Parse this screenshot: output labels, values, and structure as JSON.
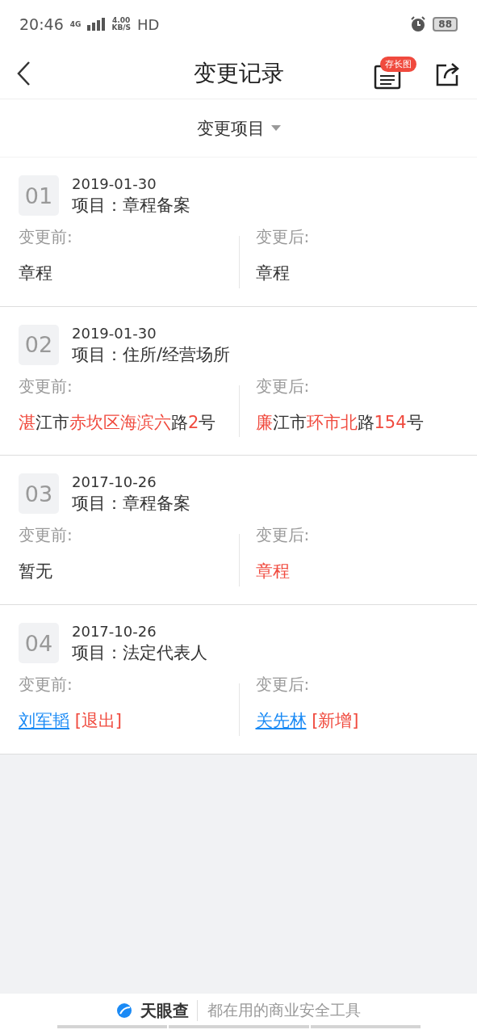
{
  "status_bar": {
    "time": "20:46",
    "network": "4G",
    "speed_value": "4.00",
    "speed_unit": "KB/S",
    "hd": "HD",
    "battery": "88"
  },
  "header": {
    "title": "变更记录",
    "badge": "存长图"
  },
  "filter": {
    "label": "变更项目"
  },
  "records": [
    {
      "index": "01",
      "date": "2019-01-30",
      "item": "项目：章程备案",
      "before_label": "变更前:",
      "after_label": "变更后:",
      "before": [
        {
          "text": "章程",
          "kind": "plain"
        }
      ],
      "after": [
        {
          "text": "章程",
          "kind": "plain"
        }
      ]
    },
    {
      "index": "02",
      "date": "2019-01-30",
      "item": "项目：住所/经营场所",
      "before_label": "变更前:",
      "after_label": "变更后:",
      "before": [
        {
          "text": "湛",
          "kind": "highlight"
        },
        {
          "text": "江市",
          "kind": "plain"
        },
        {
          "text": "赤坎区海滨六",
          "kind": "highlight"
        },
        {
          "text": "路",
          "kind": "plain"
        },
        {
          "text": "2",
          "kind": "highlight"
        },
        {
          "text": "号",
          "kind": "plain"
        }
      ],
      "after": [
        {
          "text": "廉",
          "kind": "highlight"
        },
        {
          "text": "江市",
          "kind": "plain"
        },
        {
          "text": "环市北",
          "kind": "highlight"
        },
        {
          "text": "路",
          "kind": "plain"
        },
        {
          "text": "154",
          "kind": "highlight"
        },
        {
          "text": "号",
          "kind": "plain"
        }
      ]
    },
    {
      "index": "03",
      "date": "2017-10-26",
      "item": "项目：章程备案",
      "before_label": "变更前:",
      "after_label": "变更后:",
      "before": [
        {
          "text": "暂无",
          "kind": "plain"
        }
      ],
      "after": [
        {
          "text": "章程",
          "kind": "highlight"
        }
      ]
    },
    {
      "index": "04",
      "date": "2017-10-26",
      "item": "项目：法定代表人",
      "before_label": "变更前:",
      "after_label": "变更后:",
      "before": [
        {
          "text": "刘军韬",
          "kind": "link"
        },
        {
          "text": " [退出]",
          "kind": "highlight"
        }
      ],
      "after": [
        {
          "text": "关先林",
          "kind": "link"
        },
        {
          "text": " [新增]",
          "kind": "highlight"
        }
      ]
    }
  ],
  "footer": {
    "brand": "天眼查",
    "tagline": "都在用的商业安全工具"
  }
}
